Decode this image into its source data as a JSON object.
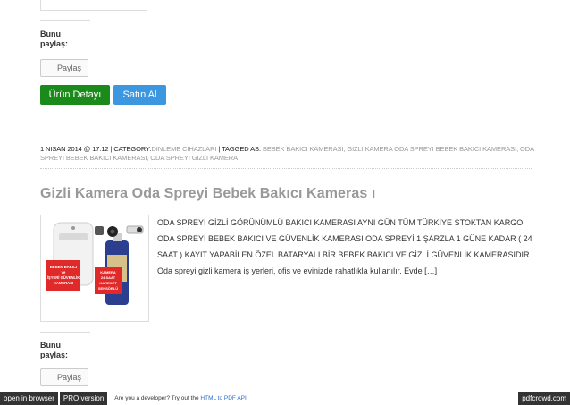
{
  "share": {
    "label_line1": "Bunu",
    "label_line2": "paylaş:",
    "button_label": "Paylaş"
  },
  "product_actions": {
    "detail_label": "Ürün Detayı",
    "buy_label": "Satın Al"
  },
  "post_meta": {
    "date": "1 NISAN 2014 @ 17:12",
    "category_prefix": " | CATEGORY:",
    "category": "DINLEME CIHAZLARI",
    "tags_prefix": " | TAGGED AS: ",
    "tags": "BEBEK BAKICI KAMERASI, GIZLI KAMERA ODA SPREYI BEBEK BAKICI KAMERASI, ODA SPREYI BEBEK BAKICI KAMERASI, ODA SPREYI GIZLI KAMERA"
  },
  "post": {
    "title": "Gizli Kamera Oda Spreyi Bebek Bakıcı Kameras ı",
    "excerpt": "ODA SPREYİ GİZLİ GÖRÜNÜMLÜ BAKICI KAMERASI      AYNI GÜN TÜM TÜRKİYE STOKTAN KARGO ODA SPREYİ BEBEK BAKICI VE GÜVENLİK KAMERASI ODA SPREYİ 1 ŞARZLA 1 GÜNE KADAR ( 24 SAAT ) KAYIT YAPABİLEN ÖZEL BATARYALI BİR BEBEK BAKICI VE GİZLİ GÜVENLİK KAMERASIDIR. Oda spreyi gizli kamera iş yerleri, ofis ve evinizde rahatlıkla kullanılır. Evde […]",
    "image_labels": {
      "left": "BEBEK BAKICI ve İŞYERİ GÜVENLİK KAMERASI",
      "right": "KAMERA 24 SAAT HAREKET SENSÖRLÜ"
    }
  },
  "footer": {
    "open_browser": "open in browser",
    "pro_version": "PRO version",
    "note_prefix": "Are you a developer? Try out the ",
    "note_link": "HTML to PDF API",
    "brand": "pdfcrowd.com"
  },
  "colors": {
    "detail_button": "#1a8a1a",
    "buy_button": "#3d97e0",
    "title": "#999999",
    "footer_dark": "#333333"
  }
}
